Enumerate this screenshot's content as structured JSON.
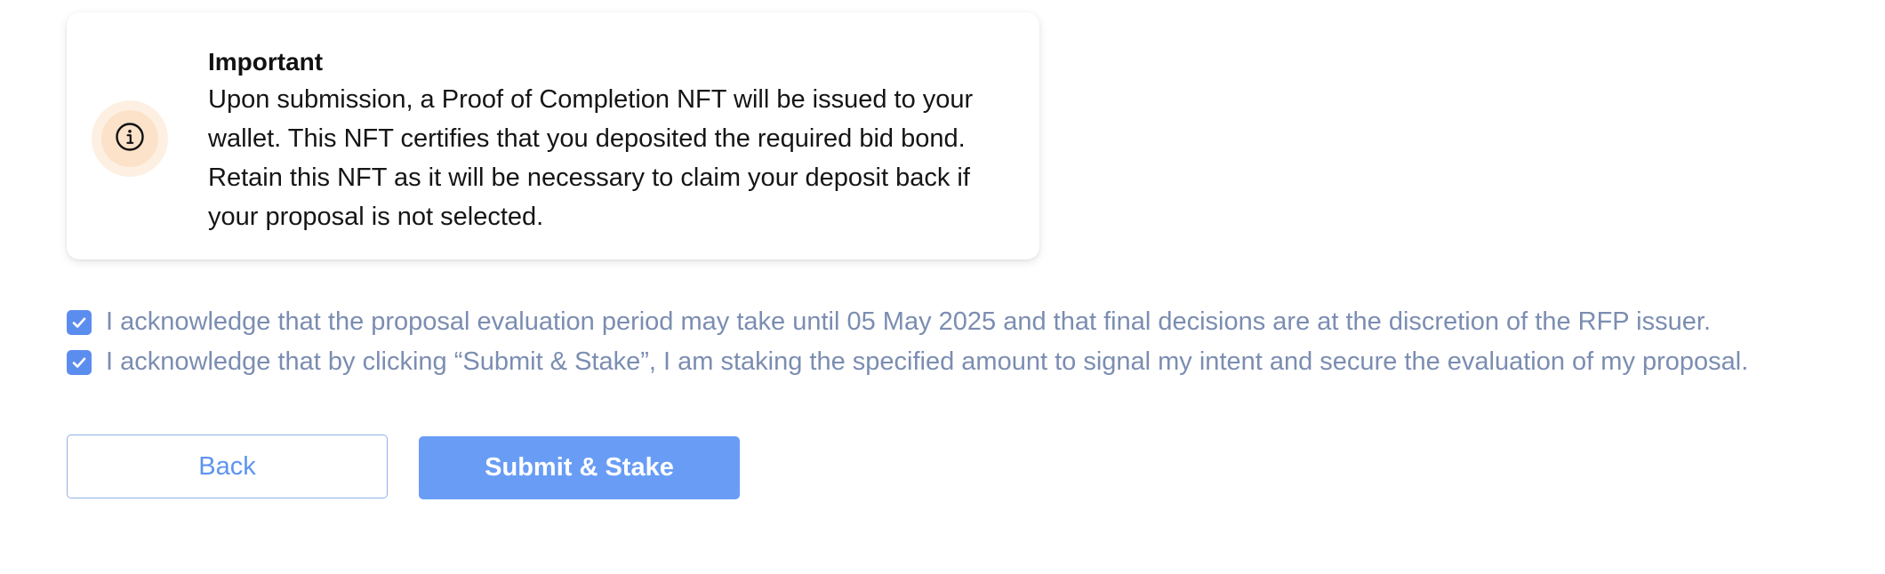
{
  "notice": {
    "icon": "info-icon",
    "title": "Important",
    "body": "Upon submission, a Proof of Completion NFT will be issued to your wallet. This NFT certifies that you deposited the required bid bond. Retain this NFT as it will be necessary to claim your deposit back if your proposal is not selected."
  },
  "acknowledgements": [
    {
      "checked": true,
      "label": "I acknowledge that the proposal evaluation period may take until 05 May 2025 and that final decisions are at the discretion of the RFP issuer."
    },
    {
      "checked": true,
      "label": "I acknowledge that by clicking “Submit & Stake”, I am staking the specified amount to signal my intent and secure the evaluation of my proposal."
    }
  ],
  "actions": {
    "back_label": "Back",
    "submit_label": "Submit & Stake"
  },
  "colors": {
    "accent": "#699df5",
    "checkbox": "#5b8def",
    "muted_text": "#7b8db1",
    "info_badge": "#fce2c8"
  }
}
